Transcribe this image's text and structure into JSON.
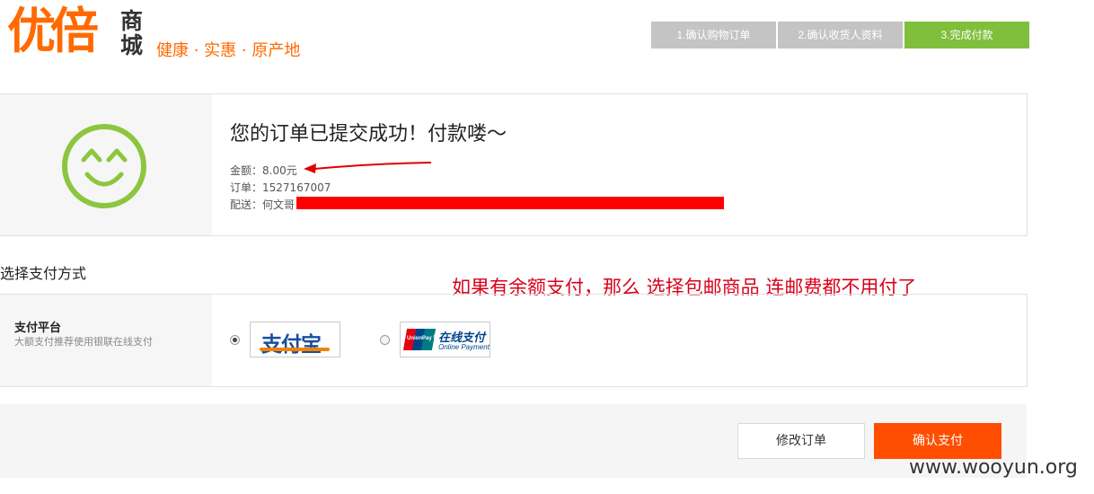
{
  "header": {
    "logo_main": "优倍",
    "logo_side": "商城",
    "slogan": "健康 · 实惠 · 原产地"
  },
  "steps": [
    {
      "label": "1.确认购物订单",
      "active": false
    },
    {
      "label": "2.确认收货人资料",
      "active": false
    },
    {
      "label": "3.完成付款",
      "active": true
    }
  ],
  "order": {
    "title": "您的订单已提交成功！付款喽～",
    "amount_label": "金额：",
    "amount_value": "8.00元",
    "order_label": "订单：",
    "order_value": "1527167007",
    "delivery_label": "配送：",
    "delivery_value": "何文哥"
  },
  "payment": {
    "section_title": "选择支付方式",
    "annotation": "如果有余额支付，那么 选择包邮商品 连邮费都不用付了",
    "platform_label": "支付平台",
    "platform_desc": "大额支付推荐使用银联在线支付",
    "options": [
      {
        "name": "支付宝",
        "selected": true
      },
      {
        "name": "在线支付",
        "sub": "Online Payment",
        "badge": "UnionPay 银联",
        "selected": false
      }
    ]
  },
  "actions": {
    "modify_label": "修改订单",
    "confirm_label": "确认支付"
  },
  "watermark": "www.wooyun.org",
  "colors": {
    "brand_orange": "#ff6a00",
    "step_active": "#7fbf3c",
    "step_inactive": "#c4c4c4",
    "confirm_button": "#ff4e00",
    "smiley_green": "#8cc63f",
    "annotation_red": "#d9001b"
  }
}
